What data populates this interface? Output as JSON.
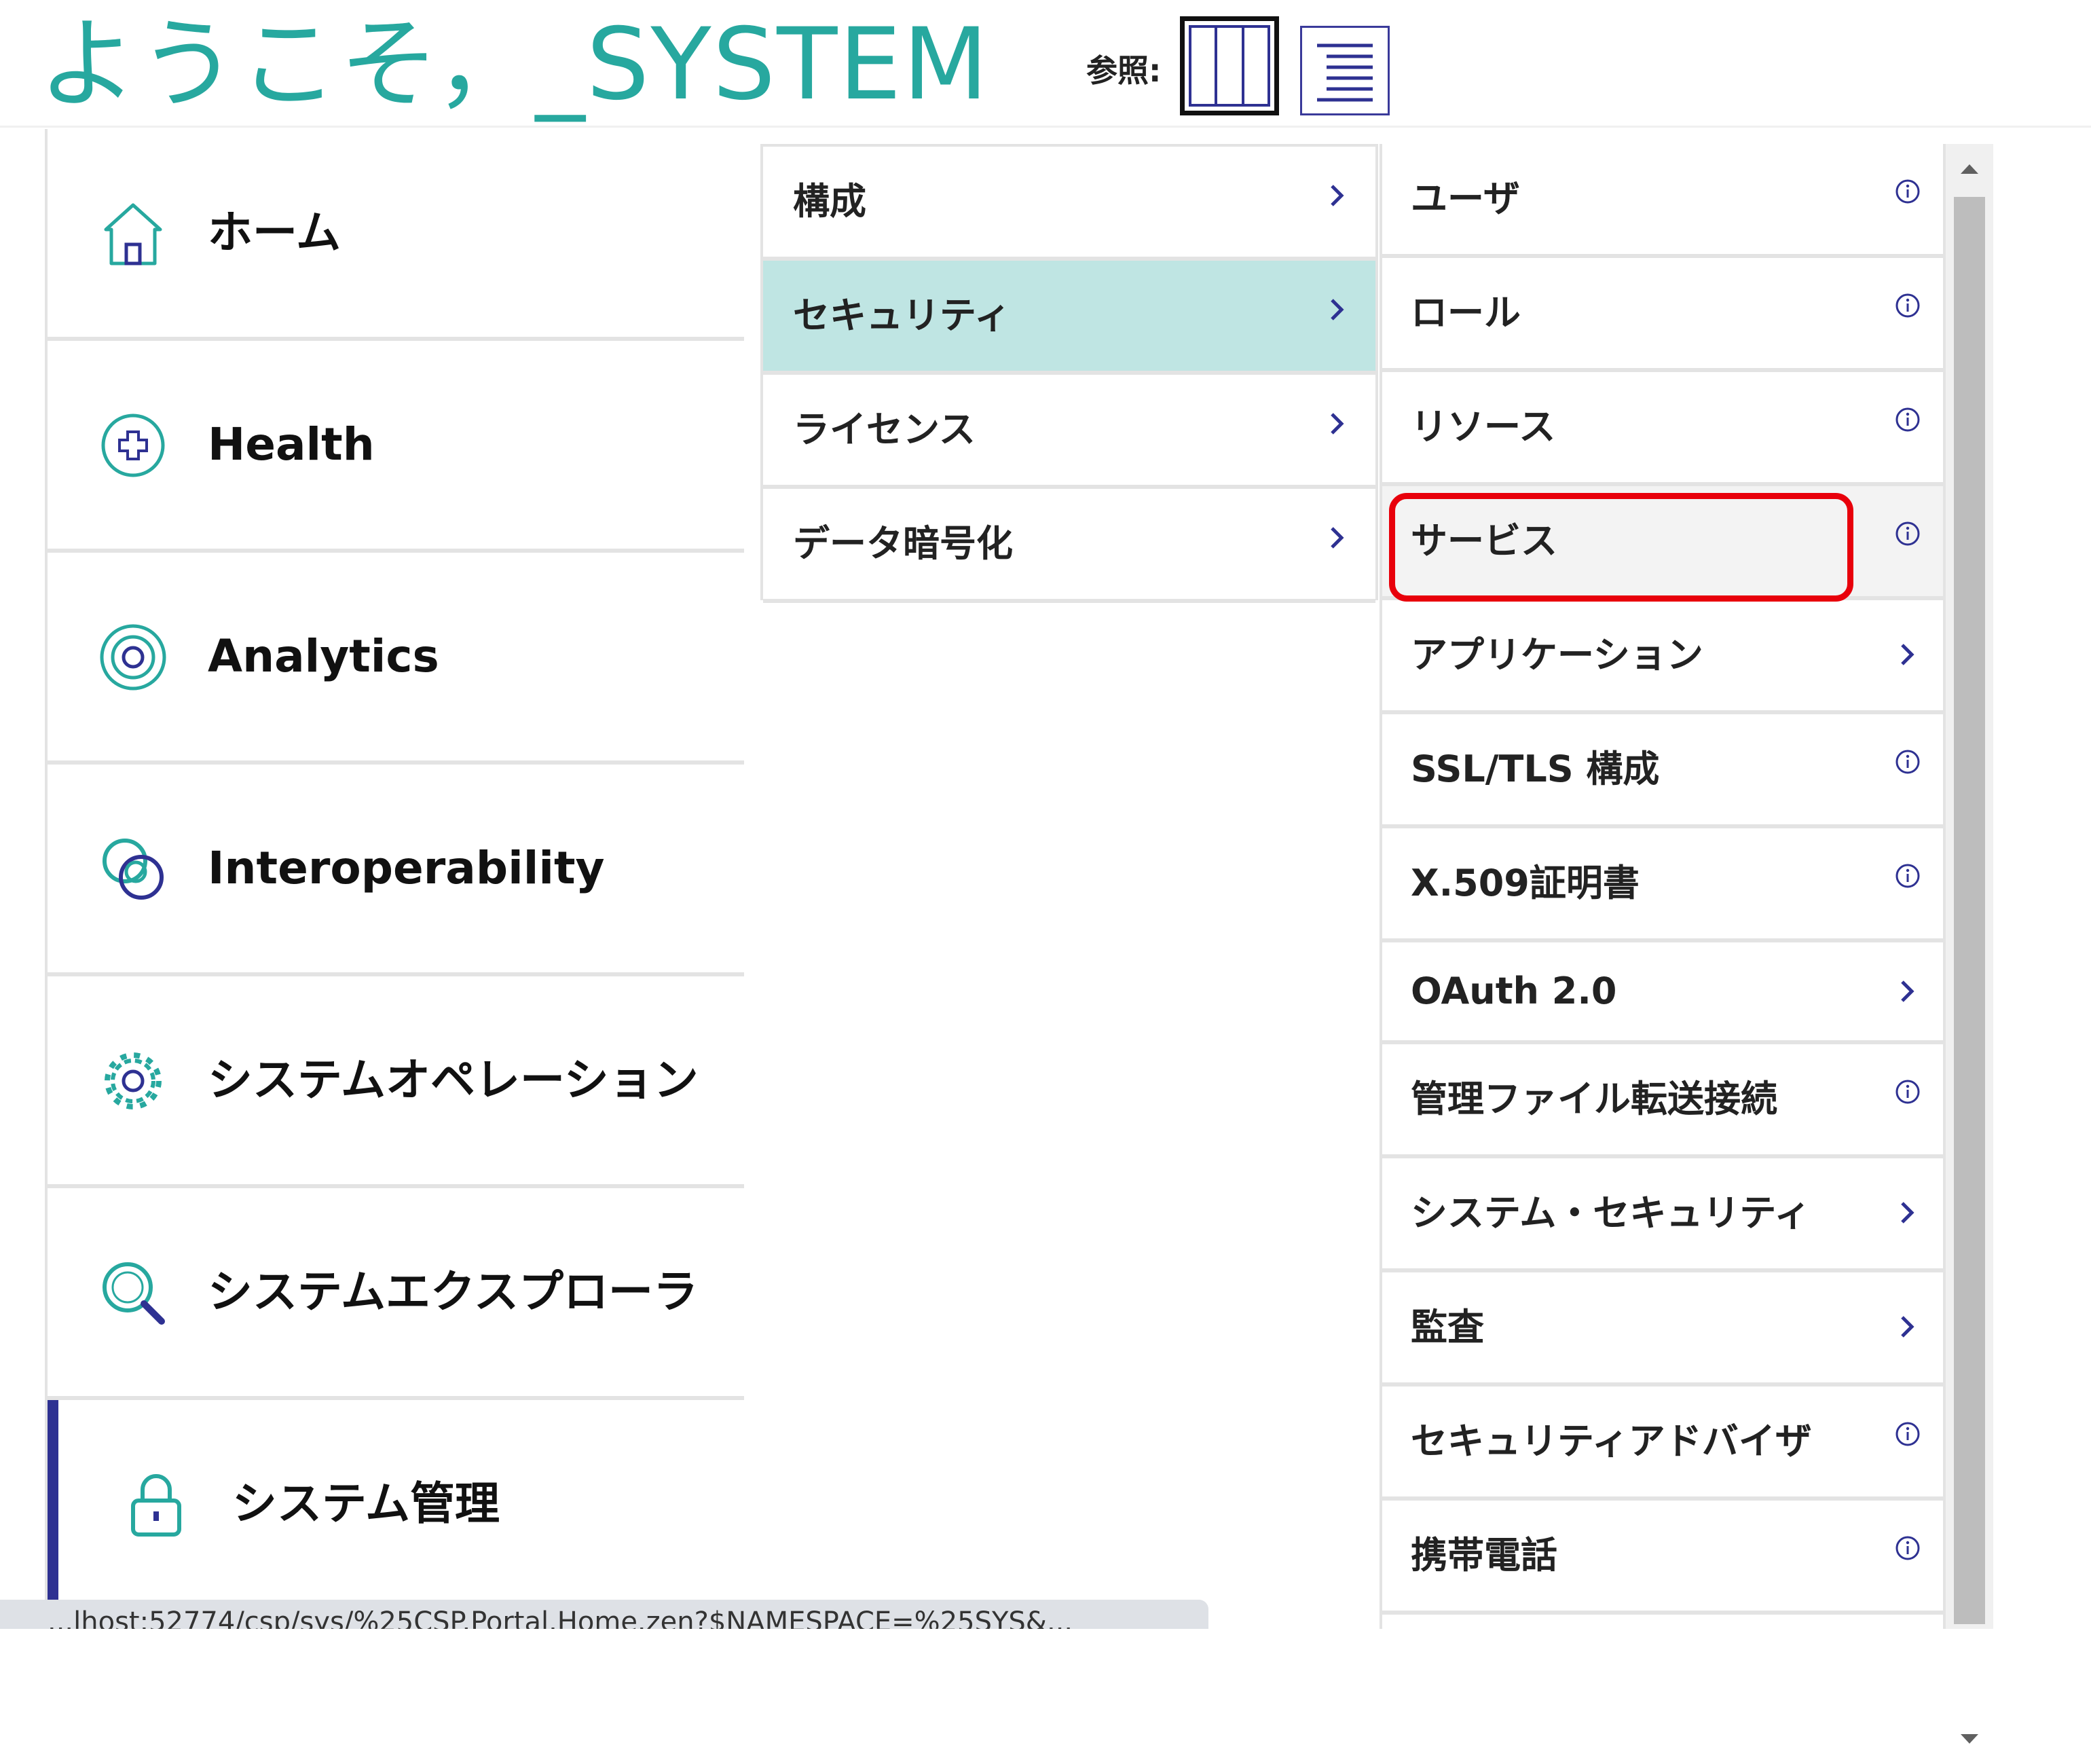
{
  "header": {
    "welcome": "ようこそ，_SYSTEM",
    "view_label": "参照:",
    "view_modes": [
      "columns-view-icon",
      "list-view-icon"
    ]
  },
  "nav": {
    "items": [
      {
        "label": "ホーム",
        "icon": "home-icon"
      },
      {
        "label": "Health",
        "icon": "health-plus-icon"
      },
      {
        "label": "Analytics",
        "icon": "target-icon"
      },
      {
        "label": "Interoperability",
        "icon": "linked-rings-icon"
      },
      {
        "label": "システムオペレーション",
        "icon": "gear-icon"
      },
      {
        "label": "システムエクスプローラ",
        "icon": "magnifier-icon"
      },
      {
        "label": "システム管理",
        "icon": "padlock-icon",
        "active": true
      }
    ]
  },
  "submenu": {
    "items": [
      {
        "label": "構成",
        "has_children": true
      },
      {
        "label": "セキュリティ",
        "has_children": true,
        "selected": true
      },
      {
        "label": "ライセンス",
        "has_children": true
      },
      {
        "label": "データ暗号化",
        "has_children": true
      }
    ]
  },
  "security_menu": {
    "items": [
      {
        "label": "ユーザ",
        "indicator": "info-icon"
      },
      {
        "label": "ロール",
        "indicator": "info-icon"
      },
      {
        "label": "リソース",
        "indicator": "info-icon"
      },
      {
        "label": "サービス",
        "indicator": "info-icon",
        "highlighted": true
      },
      {
        "label": "アプリケーション",
        "indicator": "chevron-right-icon"
      },
      {
        "label": "SSL/TLS 構成",
        "indicator": "info-icon"
      },
      {
        "label": "X.509証明書",
        "indicator": "info-icon"
      },
      {
        "label": "OAuth 2.0",
        "indicator": "chevron-right-icon"
      },
      {
        "label": "管理ファイル転送接続",
        "indicator": "info-icon"
      },
      {
        "label": "システム・セキュリティ",
        "indicator": "chevron-right-icon"
      },
      {
        "label": "監査",
        "indicator": "chevron-right-icon"
      },
      {
        "label": "セキュリティアドバイザ",
        "indicator": "info-icon"
      },
      {
        "label": "携帯電話",
        "indicator": "info-icon"
      }
    ]
  },
  "status_bar": {
    "url_text": "...lhost:52774/csp/sys/%25CSP.Portal.Home.zen?$NAMESPACE=%25SYS&..."
  },
  "colors": {
    "teal": "#27a89f",
    "navy": "#2e3192",
    "selected_bg": "#bfe5e3",
    "highlight_red": "#e8000b"
  }
}
